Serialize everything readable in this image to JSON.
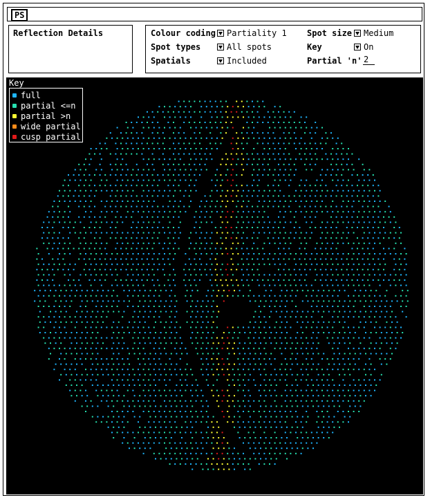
{
  "window": {
    "title": "PS"
  },
  "details": {
    "title": "Reflection Details"
  },
  "controls": {
    "colour_coding": {
      "label": "Colour coding",
      "value": "Partiality 1"
    },
    "spot_types": {
      "label": "Spot types",
      "value": "All spots"
    },
    "spatials": {
      "label": "Spatials",
      "value": "Included"
    },
    "spot_size": {
      "label": "Spot size",
      "value": "Medium"
    },
    "key": {
      "label": "Key",
      "value": "On"
    },
    "partial_n": {
      "label": "Partial 'n'",
      "value": "2"
    }
  },
  "plot": {
    "key_heading": "Key",
    "legend": [
      {
        "label": "full",
        "color": "#1fb6ff"
      },
      {
        "label": "partial <=n",
        "color": "#26e0b0"
      },
      {
        "label": "partial >n",
        "color": "#ffff33"
      },
      {
        "label": "wide partial",
        "color": "#ff8c1a"
      },
      {
        "label": "cusp partial",
        "color": "#e01a1a"
      }
    ]
  }
}
